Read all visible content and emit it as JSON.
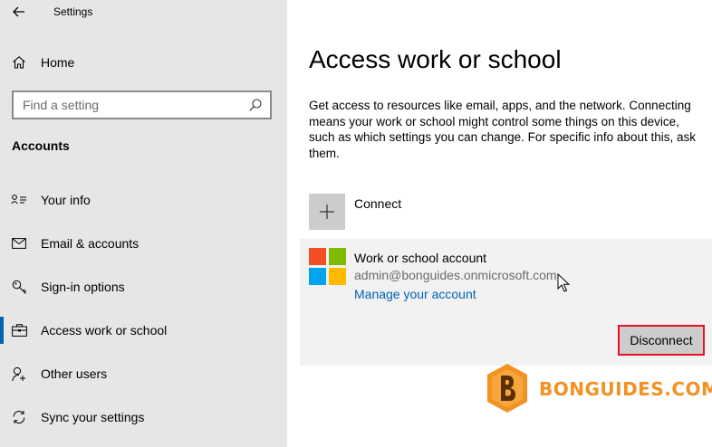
{
  "app": {
    "title": "Settings"
  },
  "sidebar": {
    "home_label": "Home",
    "search_placeholder": "Find a setting",
    "section_title": "Accounts",
    "items": [
      {
        "label": "Your info",
        "icon": "person-card-icon"
      },
      {
        "label": "Email & accounts",
        "icon": "mail-icon"
      },
      {
        "label": "Sign-in options",
        "icon": "key-icon"
      },
      {
        "label": "Access work or school",
        "icon": "briefcase-icon"
      },
      {
        "label": "Other users",
        "icon": "person-add-icon"
      },
      {
        "label": "Sync your settings",
        "icon": "sync-icon"
      }
    ],
    "active_item": "Access work or school"
  },
  "main": {
    "title": "Access work or school",
    "description": "Get access to resources like email, apps, and the network. Connecting means your work or school might control some things on this device, such as which settings you can change. For specific info about this, ask them.",
    "connect_label": "Connect",
    "account": {
      "title": "Work or school account",
      "email": "admin@bonguides.onmicrosoft.com",
      "manage_link": "Manage your account",
      "disconnect_label": "Disconnect"
    }
  },
  "watermark": {
    "text": "BONGUIDES.COM"
  },
  "colors": {
    "accent": "#0063b1",
    "sidebar_bg": "#e6e6e6",
    "highlight_border": "#e81123",
    "ms_red": "#f25022",
    "ms_green": "#7fba00",
    "ms_blue": "#00a4ef",
    "ms_yellow": "#ffb900",
    "watermark": "#f29222"
  }
}
